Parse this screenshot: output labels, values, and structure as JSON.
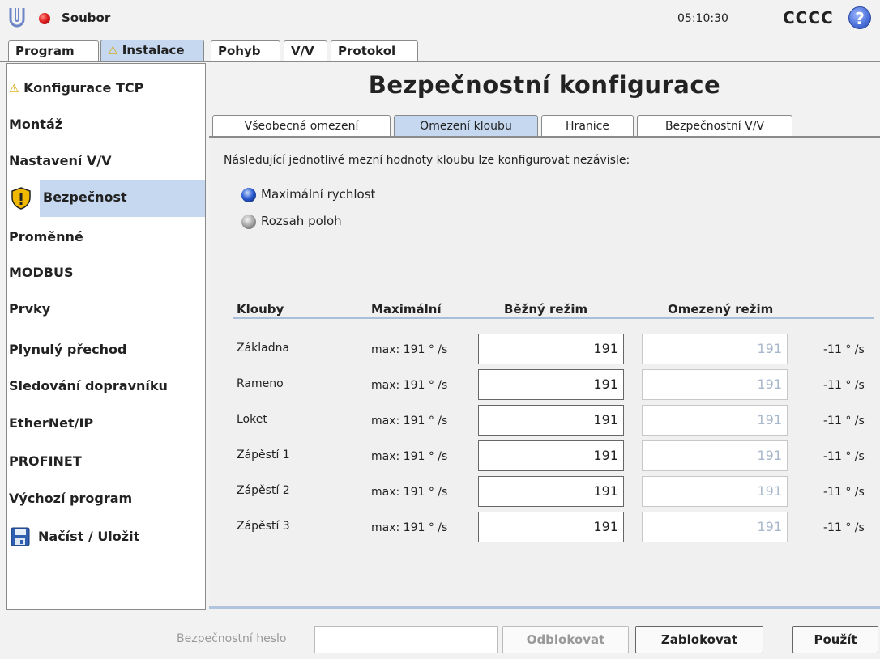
{
  "titlebar": {
    "file_label": "Soubor",
    "clock": "05:10:30",
    "robot_name": "CCCC",
    "help_glyph": "?"
  },
  "main_tabs": [
    {
      "label": "Program"
    },
    {
      "label": "Instalace",
      "warning": true
    },
    {
      "label": "Pohyb"
    },
    {
      "label": "V/V"
    },
    {
      "label": "Protokol"
    }
  ],
  "sidebar": {
    "items": [
      {
        "label": "Konfigurace TCP",
        "icon": "warning-icon"
      },
      {
        "label": "Montáž"
      },
      {
        "label": "Nastavení V/V"
      },
      {
        "label": "Bezpečnost",
        "icon": "safety-shield-icon",
        "selected": true
      },
      {
        "label": "Proměnné"
      },
      {
        "label": "MODBUS"
      },
      {
        "label": "Prvky"
      },
      {
        "label": "Plynulý přechod"
      },
      {
        "label": "Sledování dopravníku"
      },
      {
        "label": "EtherNet/IP"
      },
      {
        "label": "PROFINET"
      },
      {
        "label": "Výchozí program"
      },
      {
        "label": "Načíst / Uložit",
        "icon": "floppy-disk-icon"
      }
    ]
  },
  "panel": {
    "title": "Bezpečnostní konfigurace",
    "sub_tabs": [
      {
        "label": "Všeobecná omezení"
      },
      {
        "label": "Omezení kloubu",
        "active": true
      },
      {
        "label": "Hranice"
      },
      {
        "label": "Bezpečnostní V/V"
      }
    ],
    "description": "Následující jednotlivé mezní hodnoty kloubu lze konfigurovat nezávisle:",
    "radios": [
      {
        "label": "Maximální rychlost",
        "checked": true
      },
      {
        "label": "Rozsah poloh",
        "checked": false
      }
    ],
    "table": {
      "headers": [
        "Klouby",
        "Maximální",
        "Běžný režim",
        "Omezený režim"
      ],
      "rows": [
        {
          "joint": "Základna",
          "max": "max: 191 ° /s",
          "normal": "191",
          "reduced": "191",
          "unit": "-11 ° /s"
        },
        {
          "joint": "Rameno",
          "max": "max: 191 ° /s",
          "normal": "191",
          "reduced": "191",
          "unit": "-11 ° /s"
        },
        {
          "joint": "Loket",
          "max": "max: 191 ° /s",
          "normal": "191",
          "reduced": "191",
          "unit": "-11 ° /s"
        },
        {
          "joint": "Zápěstí 1",
          "max": "max: 191 ° /s",
          "normal": "191",
          "reduced": "191",
          "unit": "-11 ° /s"
        },
        {
          "joint": "Zápěstí 2",
          "max": "max: 191 ° /s",
          "normal": "191",
          "reduced": "191",
          "unit": "-11 ° /s"
        },
        {
          "joint": "Zápěstí 3",
          "max": "max: 191 ° /s",
          "normal": "191",
          "reduced": "191",
          "unit": "-11 ° /s"
        }
      ]
    }
  },
  "footer": {
    "password_label": "Bezpečnostní heslo",
    "password_value": "",
    "unlock_label": "Odblokovat",
    "lock_label": "Zablokovat",
    "apply_label": "Použít"
  },
  "colors": {
    "selection": "#c5d8f0",
    "status_led": "#e02020",
    "warning": "#d8a400",
    "radio_on": "#2a5bd0"
  }
}
